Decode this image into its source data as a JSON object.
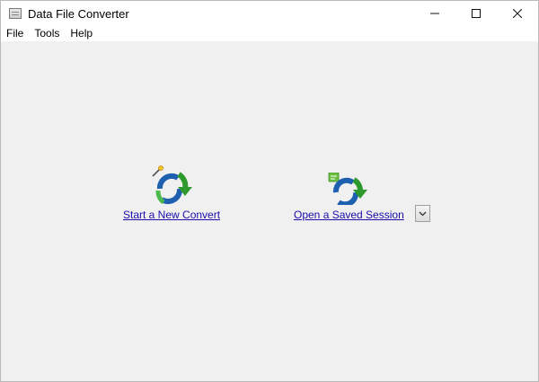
{
  "window": {
    "title": "Data File Converter",
    "controls": {
      "minimize": "—",
      "maximize": "☐",
      "close": "✕"
    }
  },
  "menu": {
    "items": [
      {
        "label": "File"
      },
      {
        "label": "Tools"
      },
      {
        "label": "Help"
      }
    ]
  },
  "main": {
    "new_convert": {
      "label": "Start a New Convert",
      "icon": "new-convert-icon"
    },
    "open_session": {
      "label": "Open a Saved Session",
      "icon": "open-session-icon"
    },
    "session_dropdown": {
      "icon": "chevron-down-icon"
    }
  },
  "colors": {
    "link": "#1a0dab",
    "arrow_green": "#2e9a2e",
    "arrow_blue": "#1f5fb0"
  }
}
